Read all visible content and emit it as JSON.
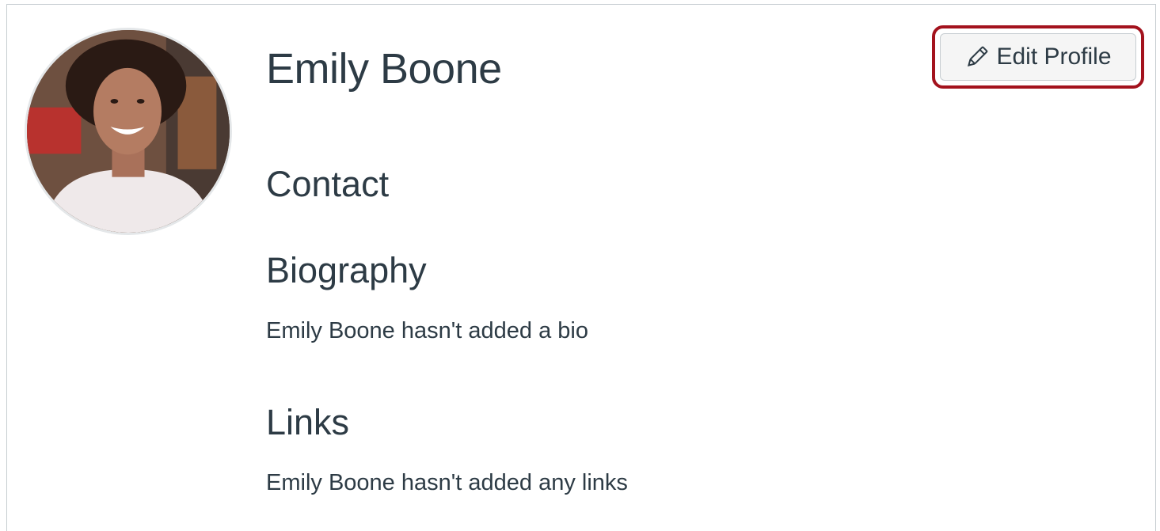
{
  "profile": {
    "name": "Emily Boone",
    "avatar_icon": "user-photo"
  },
  "actions": {
    "edit_label": "Edit Profile",
    "edit_icon": "pencil-icon",
    "highlight_color": "#a3121d"
  },
  "sections": {
    "contact": {
      "heading": "Contact"
    },
    "biography": {
      "heading": "Biography",
      "text": "Emily Boone hasn't added a bio"
    },
    "links": {
      "heading": "Links",
      "text": "Emily Boone hasn't added any links"
    }
  }
}
